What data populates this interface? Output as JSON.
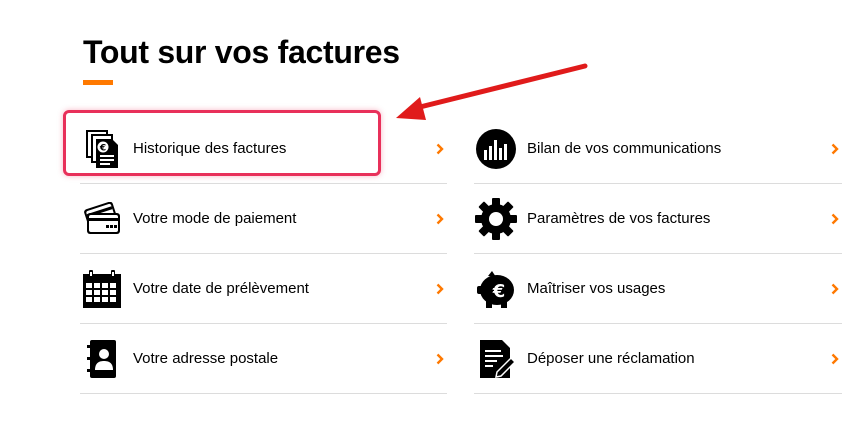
{
  "page": {
    "title": "Tout sur vos factures"
  },
  "colors": {
    "accent": "#ff7900",
    "annotation": "#e8305a",
    "arrow": "#e01b1b",
    "divider": "#dcdcdc"
  },
  "left_items": [
    {
      "label": "Historique des factures",
      "icon": "invoice-history-icon"
    },
    {
      "label": "Votre mode de paiement",
      "icon": "payment-cards-icon"
    },
    {
      "label": "Votre date de prélèvement",
      "icon": "calendar-icon"
    },
    {
      "label": "Votre adresse postale",
      "icon": "address-book-icon"
    }
  ],
  "right_items": [
    {
      "label": "Bilan de vos communications",
      "icon": "bar-chart-circle-icon"
    },
    {
      "label": "Paramètres de vos factures",
      "icon": "gear-icon"
    },
    {
      "label": "Maîtriser vos usages",
      "icon": "piggy-bank-euro-icon"
    },
    {
      "label": "Déposer une réclamation",
      "icon": "document-edit-icon"
    }
  ],
  "annotation": {
    "highlighted_item": "Historique des factures",
    "arrow": "red-arrow-pointing-left"
  }
}
